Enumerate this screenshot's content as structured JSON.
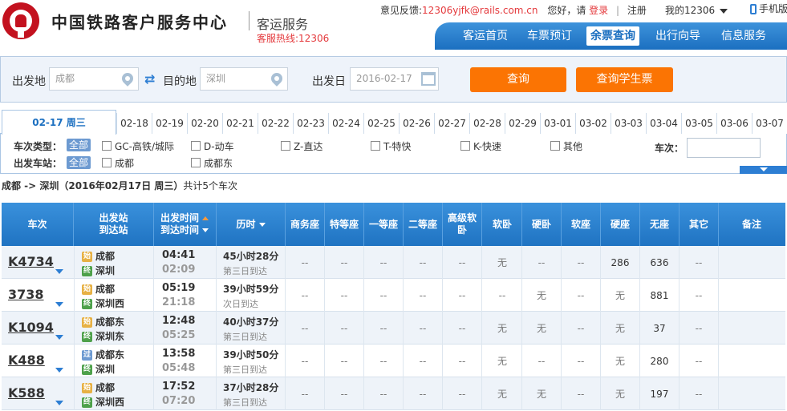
{
  "header": {
    "site_title": "中国铁路客户服务中心",
    "site_sub": "客运服务",
    "hotline": "客服热线:12306",
    "feedback_label": "意见反馈:",
    "feedback_email": "12306yjfk@rails.com.cn",
    "greeting": "您好，请",
    "login": "登录",
    "register": "注册",
    "my12306": "我的12306",
    "phone": "手机版"
  },
  "nav": [
    "客运首页",
    "车票预订",
    "余票查询",
    "出行向导",
    "信息服务"
  ],
  "search": {
    "from_label": "出发地",
    "from_value": "成都",
    "to_label": "目的地",
    "to_value": "深圳",
    "date_label": "出发日",
    "date_value": "2016-02-17",
    "query_btn": "查询",
    "student_btn": "查询学生票"
  },
  "dates": [
    "02-17 周三",
    "02-18",
    "02-19",
    "02-20",
    "02-21",
    "02-22",
    "02-23",
    "02-24",
    "02-25",
    "02-26",
    "02-27",
    "02-28",
    "02-29",
    "03-01",
    "03-02",
    "03-03",
    "03-04",
    "03-05",
    "03-06",
    "03-07"
  ],
  "filters": {
    "type_label": "车次类型：",
    "station_label": "出发车站：",
    "all": "全部",
    "types": [
      "GC-高铁/城际",
      "D-动车",
      "Z-直达",
      "T-特快",
      "K-快速",
      "其他"
    ],
    "stations": [
      "成都",
      "成都东"
    ],
    "train_no_label": "车次："
  },
  "summary": {
    "route": "成都 -> 深圳",
    "date": "（2016年02月17日  周三）",
    "count": "共计5个车次"
  },
  "columns": {
    "train": "车次",
    "station_a": "出发站",
    "station_b": "到达站",
    "time_a": "出发时间",
    "time_b": "到达时间",
    "duration": "历时",
    "seats": [
      "商务座",
      "特等座",
      "一等座",
      "二等座",
      "高级软卧",
      "软卧",
      "硬卧",
      "软座",
      "硬座",
      "无座",
      "其它"
    ],
    "remark": "备注"
  },
  "trains": [
    {
      "no": "K4734",
      "from": "成都",
      "from_type": "始",
      "to": "深圳",
      "to_type": "终",
      "dep": "04:41",
      "arr": "02:09",
      "dur": "45小时28分",
      "arrive": "第三日到达",
      "seats": [
        "--",
        "--",
        "--",
        "--",
        "--",
        "无",
        "--",
        "--",
        "286",
        "636",
        "--"
      ]
    },
    {
      "no": "3738",
      "from": "成都",
      "from_type": "始",
      "to": "深圳西",
      "to_type": "终",
      "dep": "05:19",
      "arr": "21:18",
      "dur": "39小时59分",
      "arrive": "次日到达",
      "seats": [
        "--",
        "--",
        "--",
        "--",
        "--",
        "--",
        "无",
        "--",
        "无",
        "881",
        "--"
      ]
    },
    {
      "no": "K1094",
      "from": "成都东",
      "from_type": "始",
      "to": "深圳东",
      "to_type": "终",
      "dep": "12:48",
      "arr": "05:25",
      "dur": "40小时37分",
      "arrive": "第三日到达",
      "seats": [
        "--",
        "--",
        "--",
        "--",
        "--",
        "无",
        "无",
        "--",
        "无",
        "37",
        "--"
      ]
    },
    {
      "no": "K488",
      "from": "成都东",
      "from_type": "过",
      "to": "深圳",
      "to_type": "终",
      "dep": "13:58",
      "arr": "05:48",
      "dur": "39小时50分",
      "arrive": "第三日到达",
      "seats": [
        "--",
        "--",
        "--",
        "--",
        "--",
        "无",
        "--",
        "--",
        "无",
        "280",
        "--"
      ]
    },
    {
      "no": "K588",
      "from": "成都",
      "from_type": "始",
      "to": "深圳西",
      "to_type": "终",
      "dep": "17:52",
      "arr": "07:20",
      "dur": "37小时28分",
      "arrive": "第三日到达",
      "seats": [
        "--",
        "--",
        "--",
        "--",
        "--",
        "无",
        "无",
        "--",
        "无",
        "197",
        "--"
      ]
    }
  ]
}
